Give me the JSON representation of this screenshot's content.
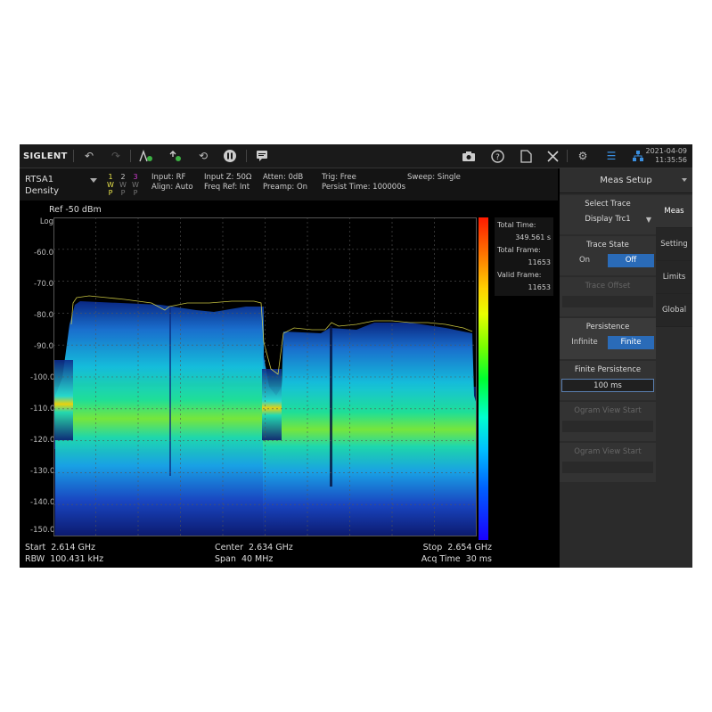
{
  "toolbar": {
    "logo": "SIGLENT",
    "icons": [
      "undo-icon",
      "redo-icon",
      "marker-icon",
      "peak-icon",
      "reset-icon",
      "pause-icon",
      "message-icon",
      "camera-icon",
      "help-icon",
      "file-icon",
      "tools-icon",
      "settings-icon",
      "list-icon",
      "network-icon"
    ],
    "date": "2021-04-09",
    "time": "11:35:56"
  },
  "infobar": {
    "mode_line1": "RTSA1",
    "mode_line2": "Density",
    "traces": [
      {
        "num": "1",
        "type": "W",
        "det": "P",
        "color": "#e8e34a"
      },
      {
        "num": "2",
        "type": "W",
        "det": "P",
        "color": "#b0b0b0"
      },
      {
        "num": "3",
        "type": "W",
        "det": "P",
        "color": "#d03ad0"
      }
    ],
    "input": "Input: RF",
    "align": "Align: Auto",
    "inputz": "Input Z: 50Ω",
    "freqref": "Freq Ref: Int",
    "atten": "Atten: 0dB",
    "preamp": "Preamp: On",
    "trig": "Trig: Free",
    "persist": "Persist Time: 100000s",
    "sweep": "Sweep: Single"
  },
  "plot": {
    "ref": "Ref  -50 dBm",
    "scale": "Log",
    "y_labels": [
      "-60.0",
      "-70.0",
      "-80.0",
      "-90.0",
      "-100.0",
      "-110.0",
      "-120.0",
      "-130.0",
      "-140.0",
      "-150.0"
    ]
  },
  "stats": {
    "total_time_label": "Total Time:",
    "total_time": "349.561 s",
    "total_frame_label": "Total Frame:",
    "total_frame": "11653",
    "valid_frame_label": "Valid Frame:",
    "valid_frame": "11653"
  },
  "bottom": {
    "start": "Start  2.614 GHz",
    "rbw": "RBW  100.431 kHz",
    "center": "Center  2.634 GHz",
    "span": "Span  40 MHz",
    "stop": "Stop  2.654 GHz",
    "acq": "Acq Time  30 ms"
  },
  "panel": {
    "title": "Meas Setup",
    "select_trace_label": "Select Trace",
    "select_trace_value": "Display Trc1",
    "trace_state_label": "Trace State",
    "trace_state_on": "On",
    "trace_state_off": "Off",
    "trace_offset": "Trace Offset",
    "persistence_label": "Persistence",
    "persistence_infinite": "Infinite",
    "persistence_finite": "Finite",
    "finite_persistence_label": "Finite Persistence",
    "finite_persistence_value": "100 ms",
    "ogram_view_start_1": "Ogram View Start",
    "ogram_view_start_2": "Ogram View Start",
    "tabs": [
      "Meas",
      "Setting",
      "Limits",
      "Global"
    ]
  }
}
